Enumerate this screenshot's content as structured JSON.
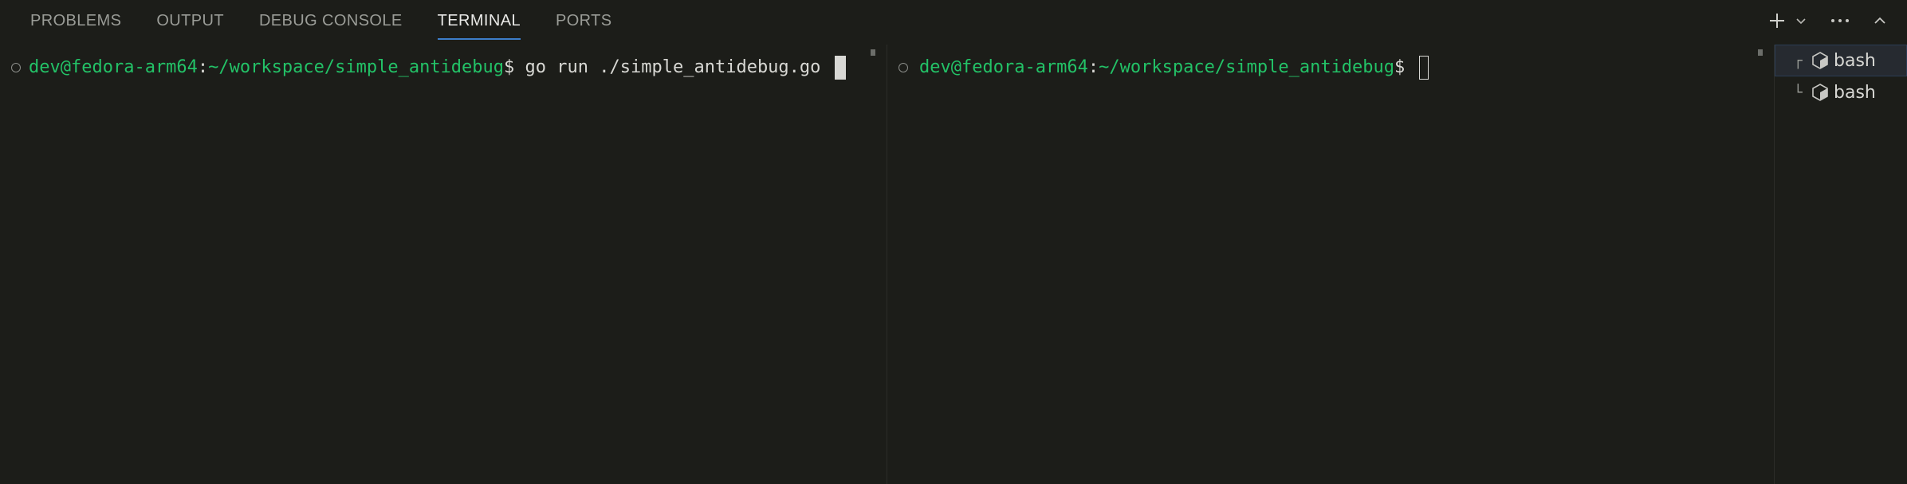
{
  "tabs": [
    {
      "label": "PROBLEMS",
      "active": false
    },
    {
      "label": "OUTPUT",
      "active": false
    },
    {
      "label": "DEBUG CONSOLE",
      "active": false
    },
    {
      "label": "TERMINAL",
      "active": true
    },
    {
      "label": "PORTS",
      "active": false
    }
  ],
  "actions": {
    "new_terminal_icon": "plus-icon",
    "dropdown_icon": "chevron-down-icon",
    "more_icon": "ellipsis-icon",
    "maximize_icon": "chevron-up-icon"
  },
  "terminals": {
    "left": {
      "user_host": "dev@fedora-arm64",
      "colon": ":",
      "path": "~/workspace/simple_antidebug",
      "prompt": "$ ",
      "command": "go run ./simple_antidebug.go "
    },
    "right": {
      "user_host": "dev@fedora-arm64",
      "colon": ":",
      "path": "~/workspace/simple_antidebug",
      "prompt": "$ ",
      "command": ""
    }
  },
  "terminal_list": [
    {
      "tree": "┌",
      "name": "bash",
      "icon": "terminal-icon",
      "selected": true
    },
    {
      "tree": "└",
      "name": "bash",
      "icon": "terminal-icon",
      "selected": false
    }
  ],
  "colors": {
    "background": "#1c1d19",
    "prompt_green": "#23c267",
    "accent_blue": "#3d7ec9",
    "text": "#d8d8d4"
  }
}
